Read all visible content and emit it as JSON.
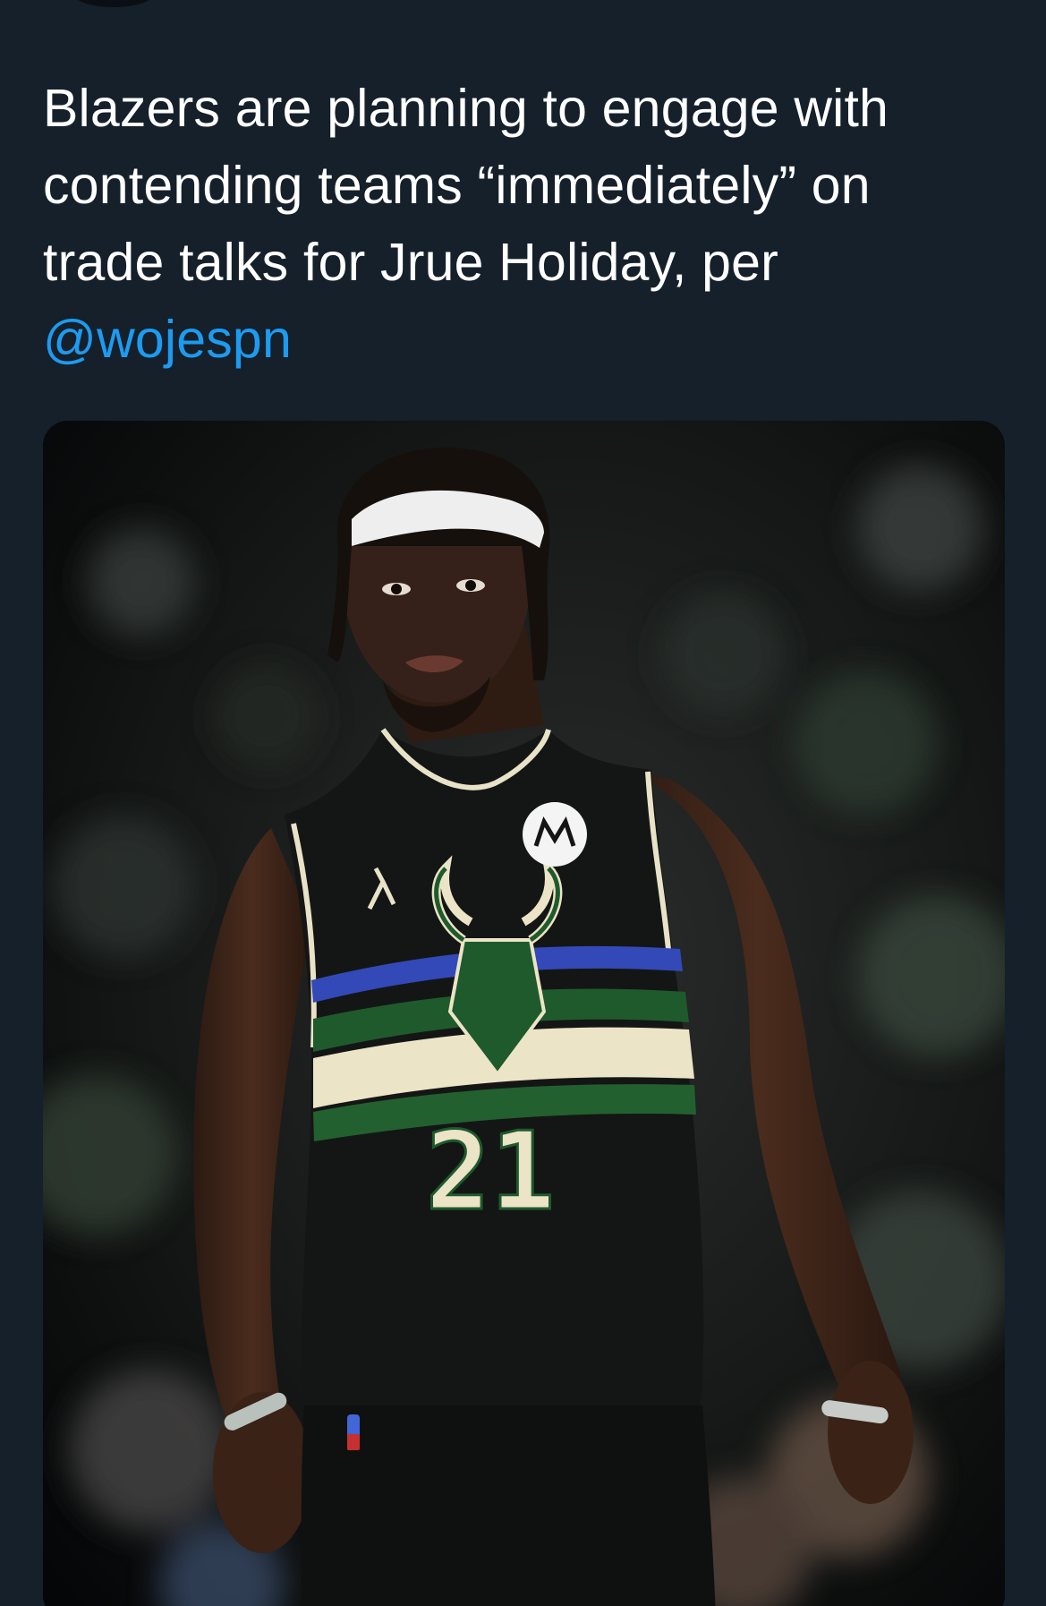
{
  "tweet": {
    "text_line1": "Blazers are planning to engage with",
    "text_line2": "contending teams “immediately” on",
    "text_line3": "trade talks for Jrue Holiday, per",
    "mention": "@wojespn"
  },
  "media": {
    "jersey_number": "21"
  },
  "colors": {
    "background": "#15202b",
    "text": "#ffffff",
    "link": "#1d9bf0"
  }
}
